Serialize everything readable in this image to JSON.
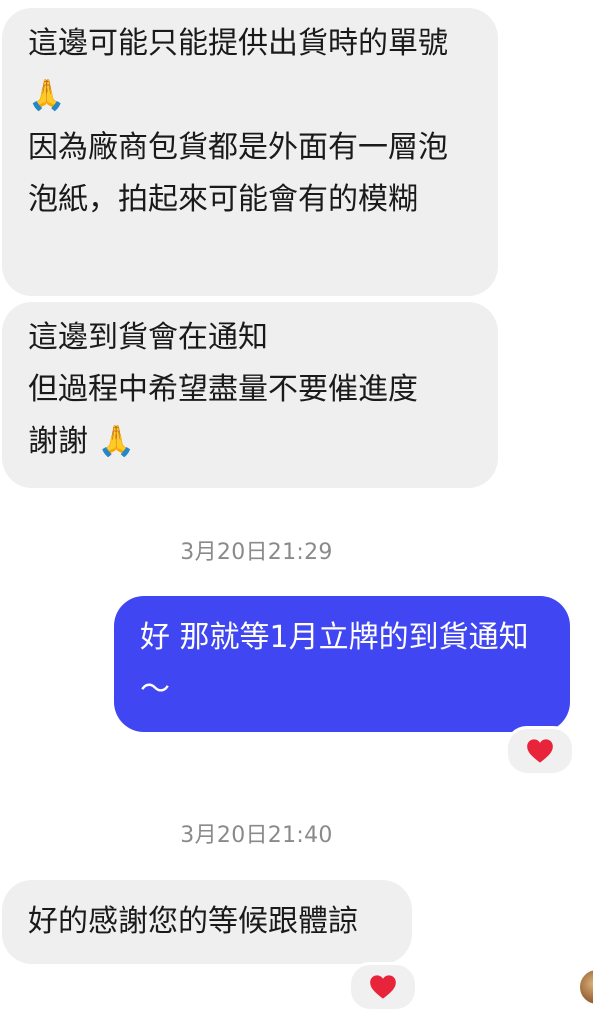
{
  "messages": {
    "incoming_1": "這邊可能只能提供出貨時的單號 🙏\n因為廠商包貨都是外面有一層泡泡紙，拍起來可能會有的模糊",
    "incoming_2": "這邊到貨會在通知\n但過程中希望盡量不要催進度\n謝謝 🙏",
    "outgoing_1": "好 那就等1月立牌的到貨通知～",
    "incoming_3": "好的感謝您的等候跟體諒"
  },
  "timestamps": {
    "first": "3月20日21:29",
    "second": "3月20日21:40"
  },
  "reactions": {
    "outgoing_1": "heart-icon",
    "incoming_3": "heart-icon"
  },
  "colors": {
    "outgoing_bubble": "#4046f1",
    "incoming_bubble": "#efefef",
    "heart": "#e8243a"
  }
}
